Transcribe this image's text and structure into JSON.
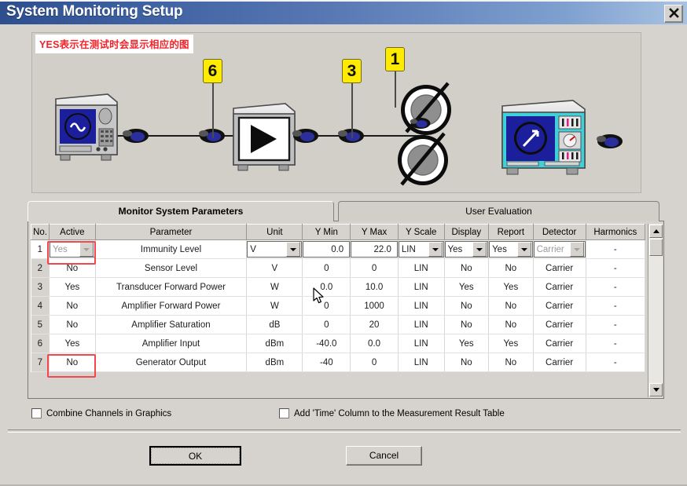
{
  "window": {
    "title": "System Monitoring Setup",
    "close_icon": "close-x-icon"
  },
  "diagram": {
    "annotation_note": "YES表示在测试时会显示相应的图",
    "badges": [
      {
        "label": "6"
      },
      {
        "label": "3"
      },
      {
        "label": "1"
      }
    ],
    "devices": [
      {
        "name": "signal-generator",
        "icon": "sine-wave-instrument-icon"
      },
      {
        "name": "amplifier",
        "icon": "triangle-amplifier-icon"
      },
      {
        "name": "antenna-1",
        "icon": "antenna-coil-icon"
      },
      {
        "name": "antenna-2",
        "icon": "antenna-coil-icon"
      },
      {
        "name": "field-meter",
        "icon": "arrow-meter-instrument-icon"
      }
    ]
  },
  "tabs": [
    {
      "label": "Monitor System Parameters",
      "selected": true
    },
    {
      "label": "User Evaluation",
      "selected": false
    }
  ],
  "table": {
    "columns": [
      "No.",
      "Active",
      "Parameter",
      "Unit",
      "Y Min",
      "Y Max",
      "Y Scale",
      "Display",
      "Report",
      "Detector",
      "Harmonics"
    ],
    "rows": [
      {
        "no": "1",
        "active": "Yes",
        "parameter": "Immunity Level",
        "unit": "V",
        "y_min": "0.0",
        "y_max": "22.0",
        "y_scale": "LIN",
        "display": "Yes",
        "report": "Yes",
        "detector": "Carrier",
        "harmonics": "-"
      },
      {
        "no": "2",
        "active": "No",
        "parameter": "Sensor Level",
        "unit": "V",
        "y_min": "0",
        "y_max": "0",
        "y_scale": "LIN",
        "display": "No",
        "report": "No",
        "detector": "Carrier",
        "harmonics": "-"
      },
      {
        "no": "3",
        "active": "Yes",
        "parameter": "Transducer Forward Power",
        "unit": "W",
        "y_min": "0.0",
        "y_max": "10.0",
        "y_scale": "LIN",
        "display": "Yes",
        "report": "Yes",
        "detector": "Carrier",
        "harmonics": "-"
      },
      {
        "no": "4",
        "active": "No",
        "parameter": "Amplifier Forward Power",
        "unit": "W",
        "y_min": "0",
        "y_max": "1000",
        "y_scale": "LIN",
        "display": "No",
        "report": "No",
        "detector": "Carrier",
        "harmonics": "-"
      },
      {
        "no": "5",
        "active": "No",
        "parameter": "Amplifier Saturation",
        "unit": "dB",
        "y_min": "0",
        "y_max": "20",
        "y_scale": "LIN",
        "display": "No",
        "report": "No",
        "detector": "Carrier",
        "harmonics": "-"
      },
      {
        "no": "6",
        "active": "Yes",
        "parameter": "Amplifier Input",
        "unit": "dBm",
        "y_min": "-40.0",
        "y_max": "0.0",
        "y_scale": "LIN",
        "display": "Yes",
        "report": "Yes",
        "detector": "Carrier",
        "harmonics": "-"
      },
      {
        "no": "7",
        "active": "No",
        "parameter": "Generator Output",
        "unit": "dBm",
        "y_min": "-40",
        "y_max": "0",
        "y_scale": "LIN",
        "display": "No",
        "report": "No",
        "detector": "Carrier",
        "harmonics": "-"
      }
    ]
  },
  "options": {
    "combine_channels": "Combine Channels in Graphics",
    "add_time_column": "Add 'Time' Column to the Measurement Result Table"
  },
  "buttons": {
    "ok": "OK",
    "cancel": "Cancel"
  },
  "colors": {
    "title_bar_start": "#2e4e8e",
    "title_bar_end": "#a8c2e2",
    "dialog_face": "#d6d3ce",
    "annotation_red": "#f0242b",
    "badge_yellow": "#ffeb00"
  }
}
